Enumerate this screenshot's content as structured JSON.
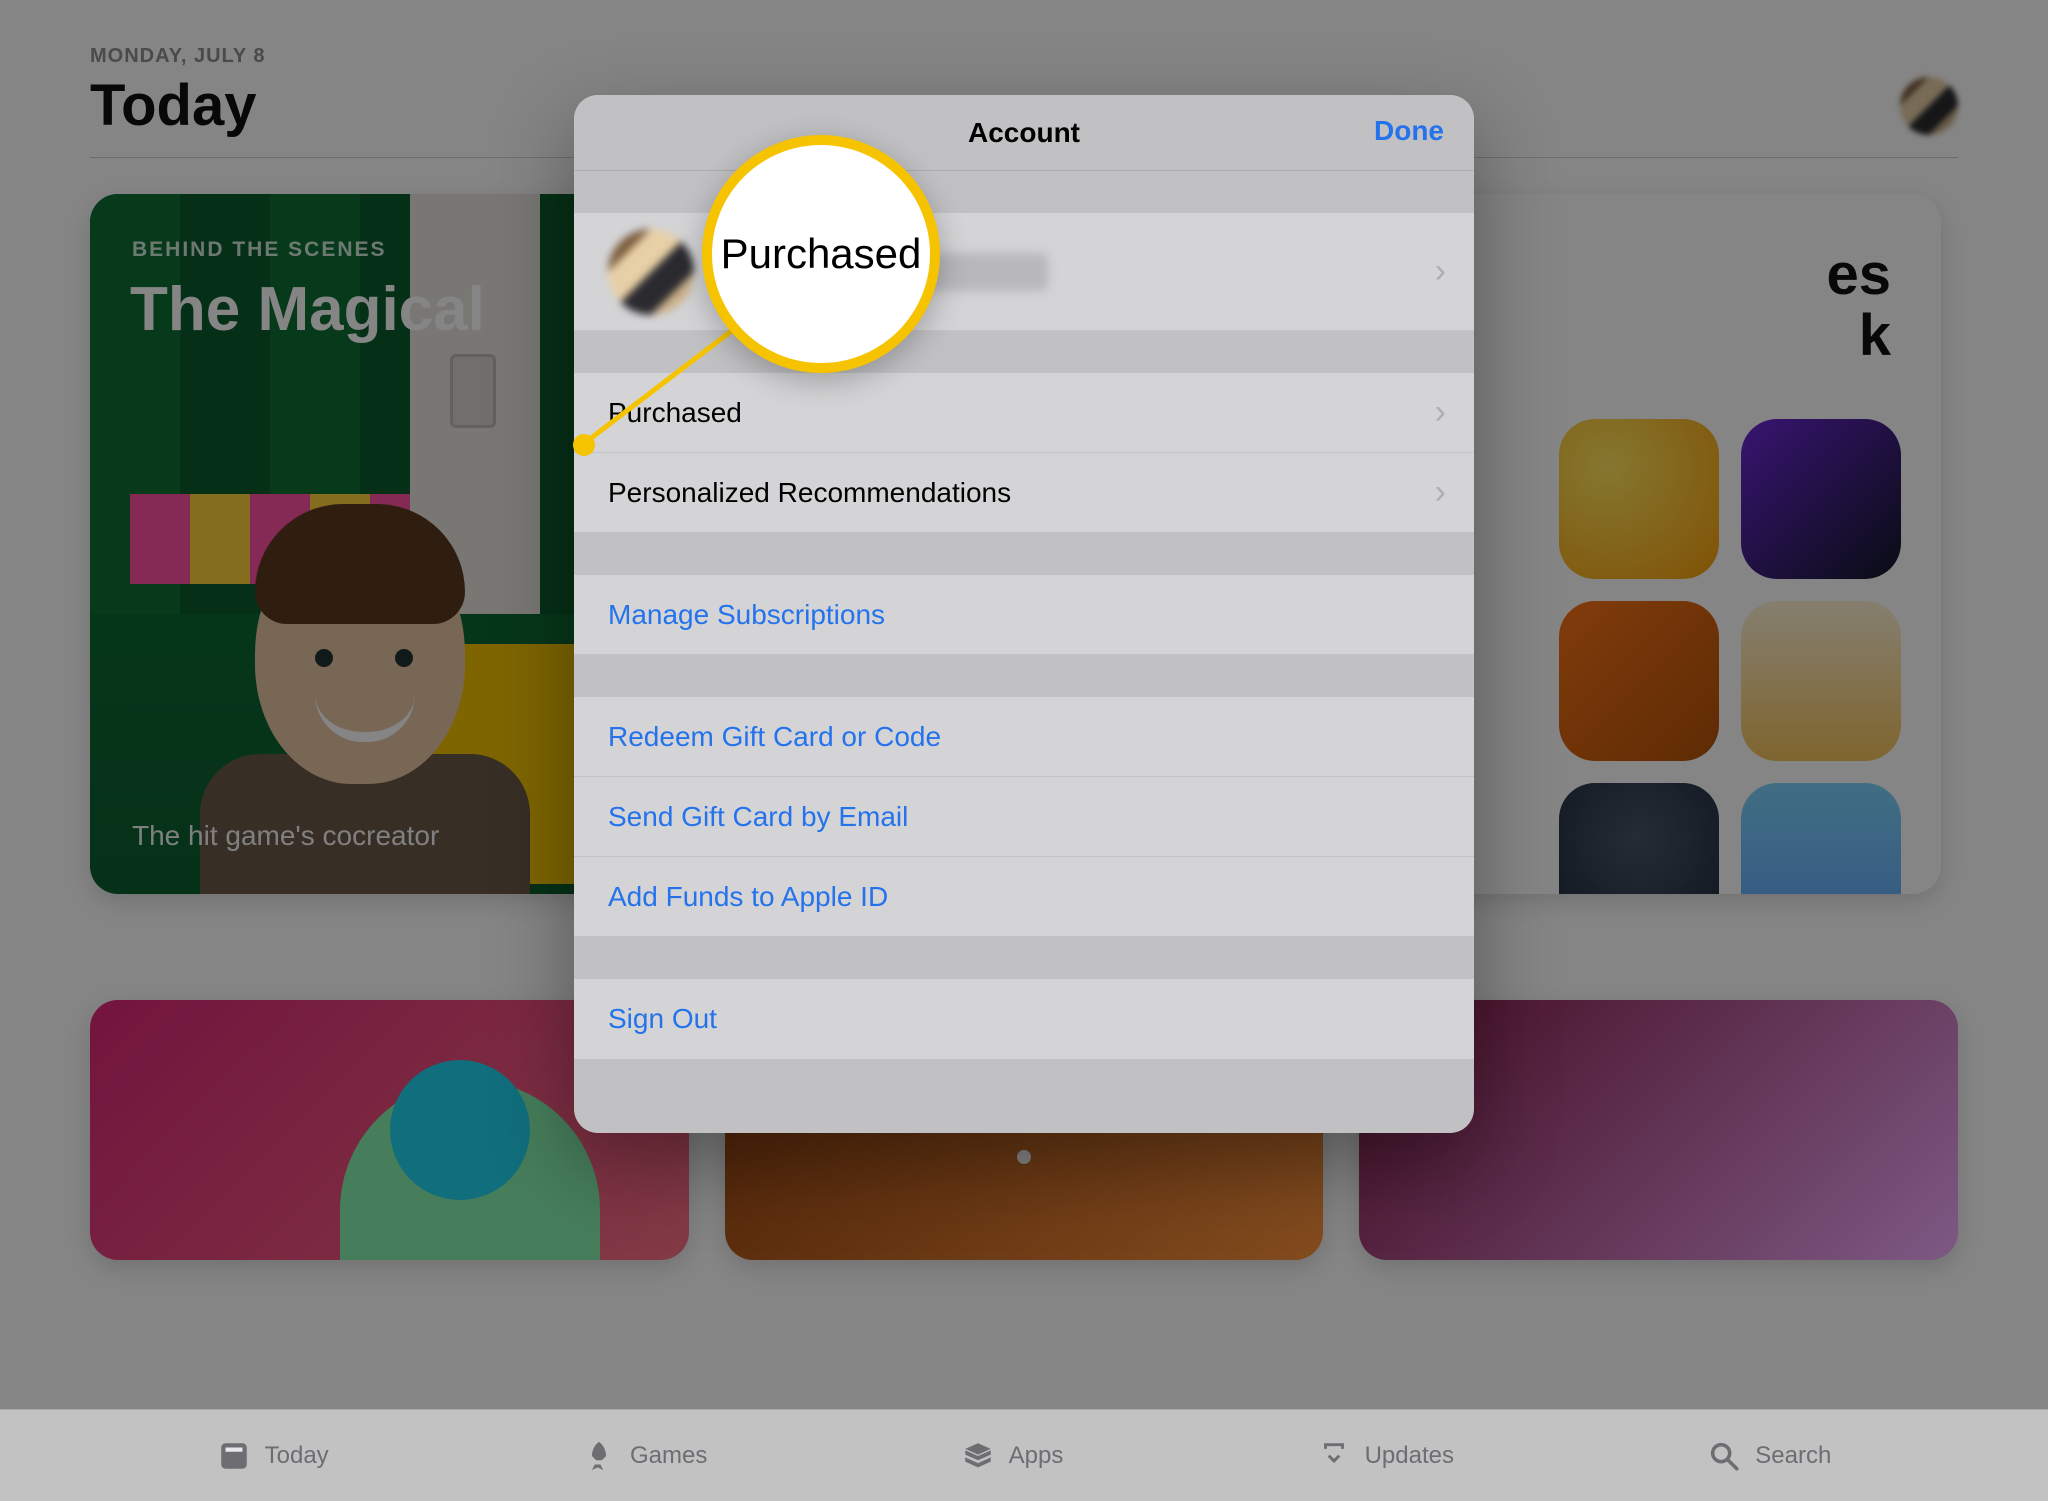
{
  "header": {
    "date": "MONDAY, JULY 8",
    "title": "Today"
  },
  "featured_card": {
    "kicker": "BEHIND THE SCENES",
    "heading_prefix": "The Magical ",
    "caption_prefix": "The hit game's cocreator"
  },
  "right_card": {
    "title_suffix_line1": "es",
    "title_suffix_line2": "k"
  },
  "tabbar": {
    "today": "Today",
    "games": "Games",
    "apps": "Apps",
    "updates": "Updates",
    "search": "Search"
  },
  "sheet": {
    "title": "Account",
    "done": "Done",
    "rows": {
      "purchased": "Purchased",
      "recommendations": "Personalized Recommendations",
      "subscriptions": "Manage Subscriptions",
      "redeem": "Redeem Gift Card or Code",
      "send_gift": "Send Gift Card by Email",
      "add_funds": "Add Funds to Apple ID",
      "sign_out": "Sign Out"
    }
  },
  "callout": {
    "label": "Purchased"
  },
  "colors": {
    "link": "#2473ed",
    "highlight": "#f6c300"
  }
}
